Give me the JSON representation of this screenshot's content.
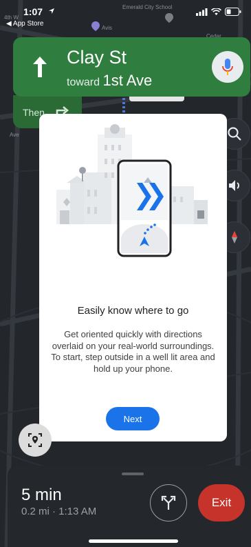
{
  "status_bar": {
    "time": "1:07",
    "back_label": "◀ App Store"
  },
  "map": {
    "labels": {
      "school": "Emerald City School",
      "avis": "Avis",
      "cedar": "Cedar",
      "ave": "Ave",
      "wave": "4th W"
    }
  },
  "navigation": {
    "street": "Clay St",
    "toward_prefix": "toward",
    "toward_street": "1st Ave",
    "then_label": "Then"
  },
  "dialog": {
    "title": "Easily know where to go",
    "body": "Get oriented quickly with directions overlaid on your real-world surroundings. To start, step outside in a well lit area and hold up your phone.",
    "next_label": "Next"
  },
  "bottom_sheet": {
    "eta": "5 min",
    "detail": "0.2 mi · 1:13 AM",
    "exit_label": "Exit"
  },
  "colors": {
    "nav_green": "#2f7d3f",
    "primary_blue": "#1a73e8",
    "exit_red": "#c5332b"
  }
}
